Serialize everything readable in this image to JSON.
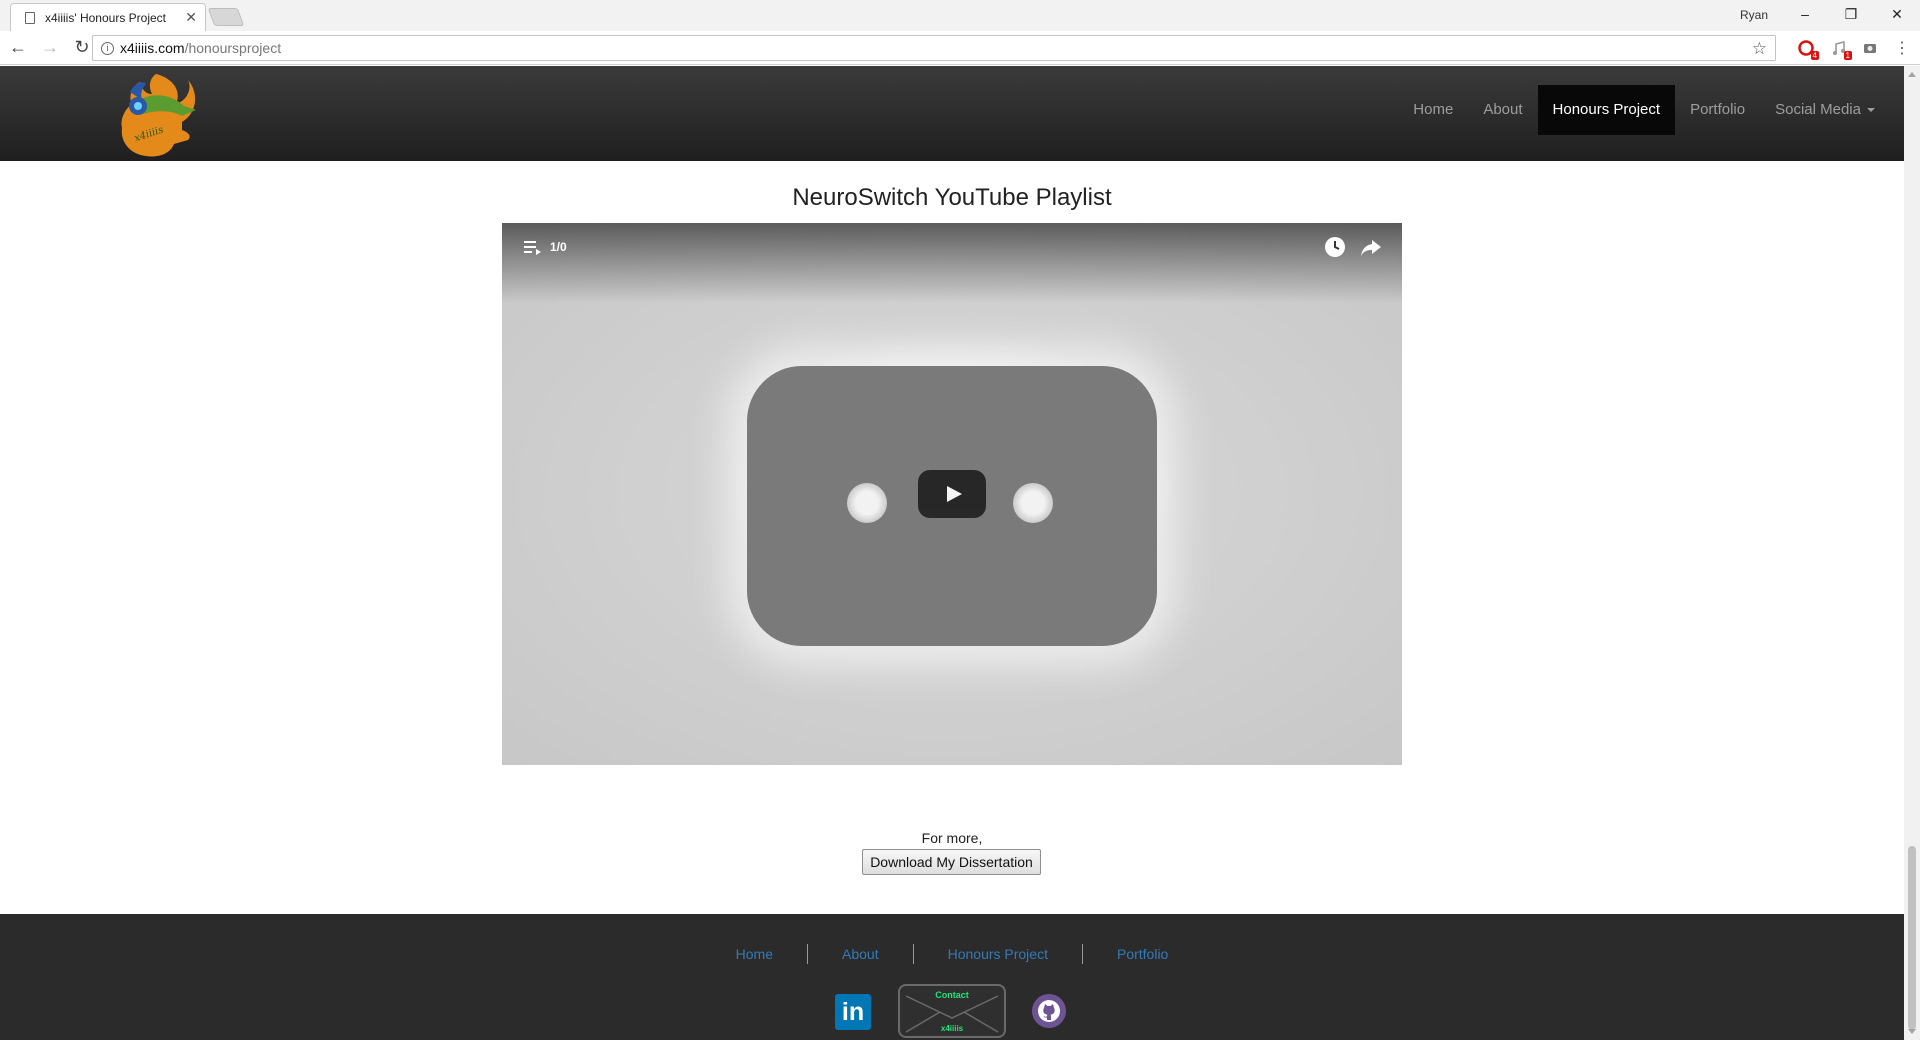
{
  "browser": {
    "tab_title": "x4iiiis' Honours Project",
    "tab_close": "✕",
    "profile_name": "Ryan",
    "url_host": "x4iiiis.com",
    "url_path": "/honoursproject",
    "window_controls": {
      "minimize": "–",
      "restore": "❐",
      "close": "✕"
    },
    "extensions": [
      {
        "icon": "opera-adblock-icon",
        "badge": "4"
      },
      {
        "icon": "music-extension-icon",
        "badge": "1"
      },
      {
        "icon": "camera-extension-icon",
        "badge": ""
      }
    ]
  },
  "site_nav": {
    "logo": "x4iiiis-logo",
    "items": [
      {
        "label": "Home"
      },
      {
        "label": "About"
      },
      {
        "label": "Honours Project",
        "active": true
      },
      {
        "label": "Portfolio"
      },
      {
        "label": "Social Media"
      }
    ]
  },
  "main": {
    "heading": "NeuroSwitch YouTube Playlist",
    "video": {
      "playlist_count": "1/0",
      "icons": [
        "playlist-icon",
        "play-icon",
        "clock-icon",
        "share-icon"
      ]
    },
    "for_more": "For more,",
    "download_label": "Download My Dissertation"
  },
  "footer": {
    "links": [
      {
        "label": "Home"
      },
      {
        "label": "About"
      },
      {
        "label": "Honours Project"
      },
      {
        "label": "Portfolio"
      }
    ],
    "linkedin_label": "in",
    "contact_label": "Contact",
    "contact_sub": "x4iiiis",
    "link_color": "#337ab7"
  },
  "colors": {
    "navbar_bg": "#222222",
    "active_nav_bg": "#080808",
    "footer_bg": "#2b2b2b",
    "contact_green": "#26e07a"
  }
}
